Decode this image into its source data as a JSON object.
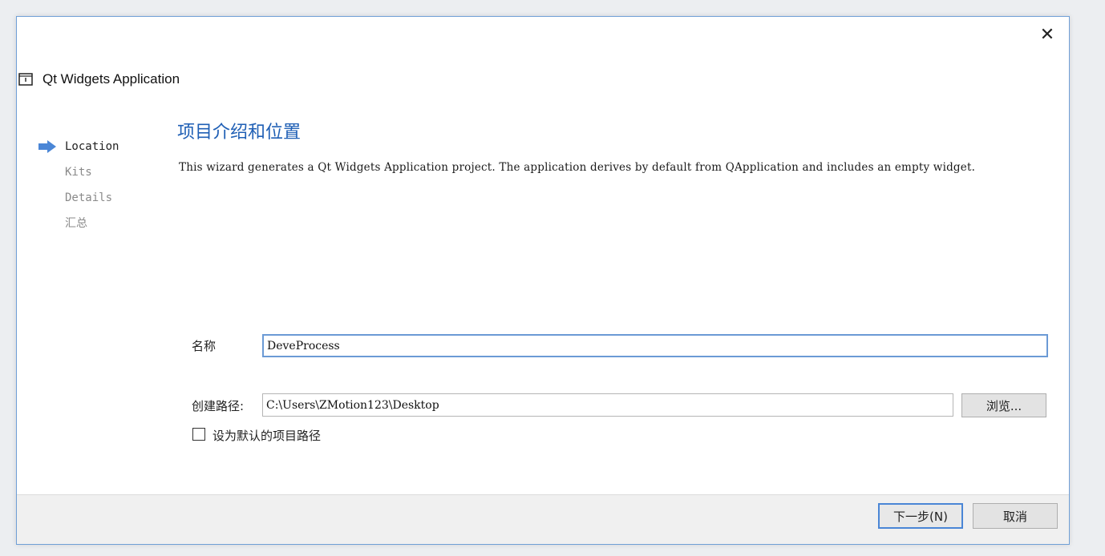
{
  "window": {
    "title": "Qt Widgets Application",
    "close_glyph": "✕"
  },
  "steps": [
    {
      "label": "Location",
      "active": true
    },
    {
      "label": "Kits",
      "active": false
    },
    {
      "label": "Details",
      "active": false
    },
    {
      "label": "汇总",
      "active": false
    }
  ],
  "page": {
    "title": "项目介绍和位置",
    "description": "This wizard generates a Qt Widgets Application project. The application derives by default from QApplication and includes an empty widget."
  },
  "form": {
    "name_label": "名称",
    "name_value": "DeveProcess",
    "path_label": "创建路径:",
    "path_value": "C:\\Users\\ZMotion123\\Desktop",
    "browse_label": "浏览...",
    "default_checkbox_label": "设为默认的项目路径",
    "default_checked": false
  },
  "footer": {
    "next_label": "下一步(N)",
    "cancel_label": "取消"
  },
  "colors": {
    "accent": "#1f5fb5",
    "arrow": "#4a86d6",
    "focus_border": "#6b9ad5"
  },
  "icons": {
    "app": "qt-app-icon",
    "current_step": "arrow-right-icon",
    "close": "close-icon"
  }
}
